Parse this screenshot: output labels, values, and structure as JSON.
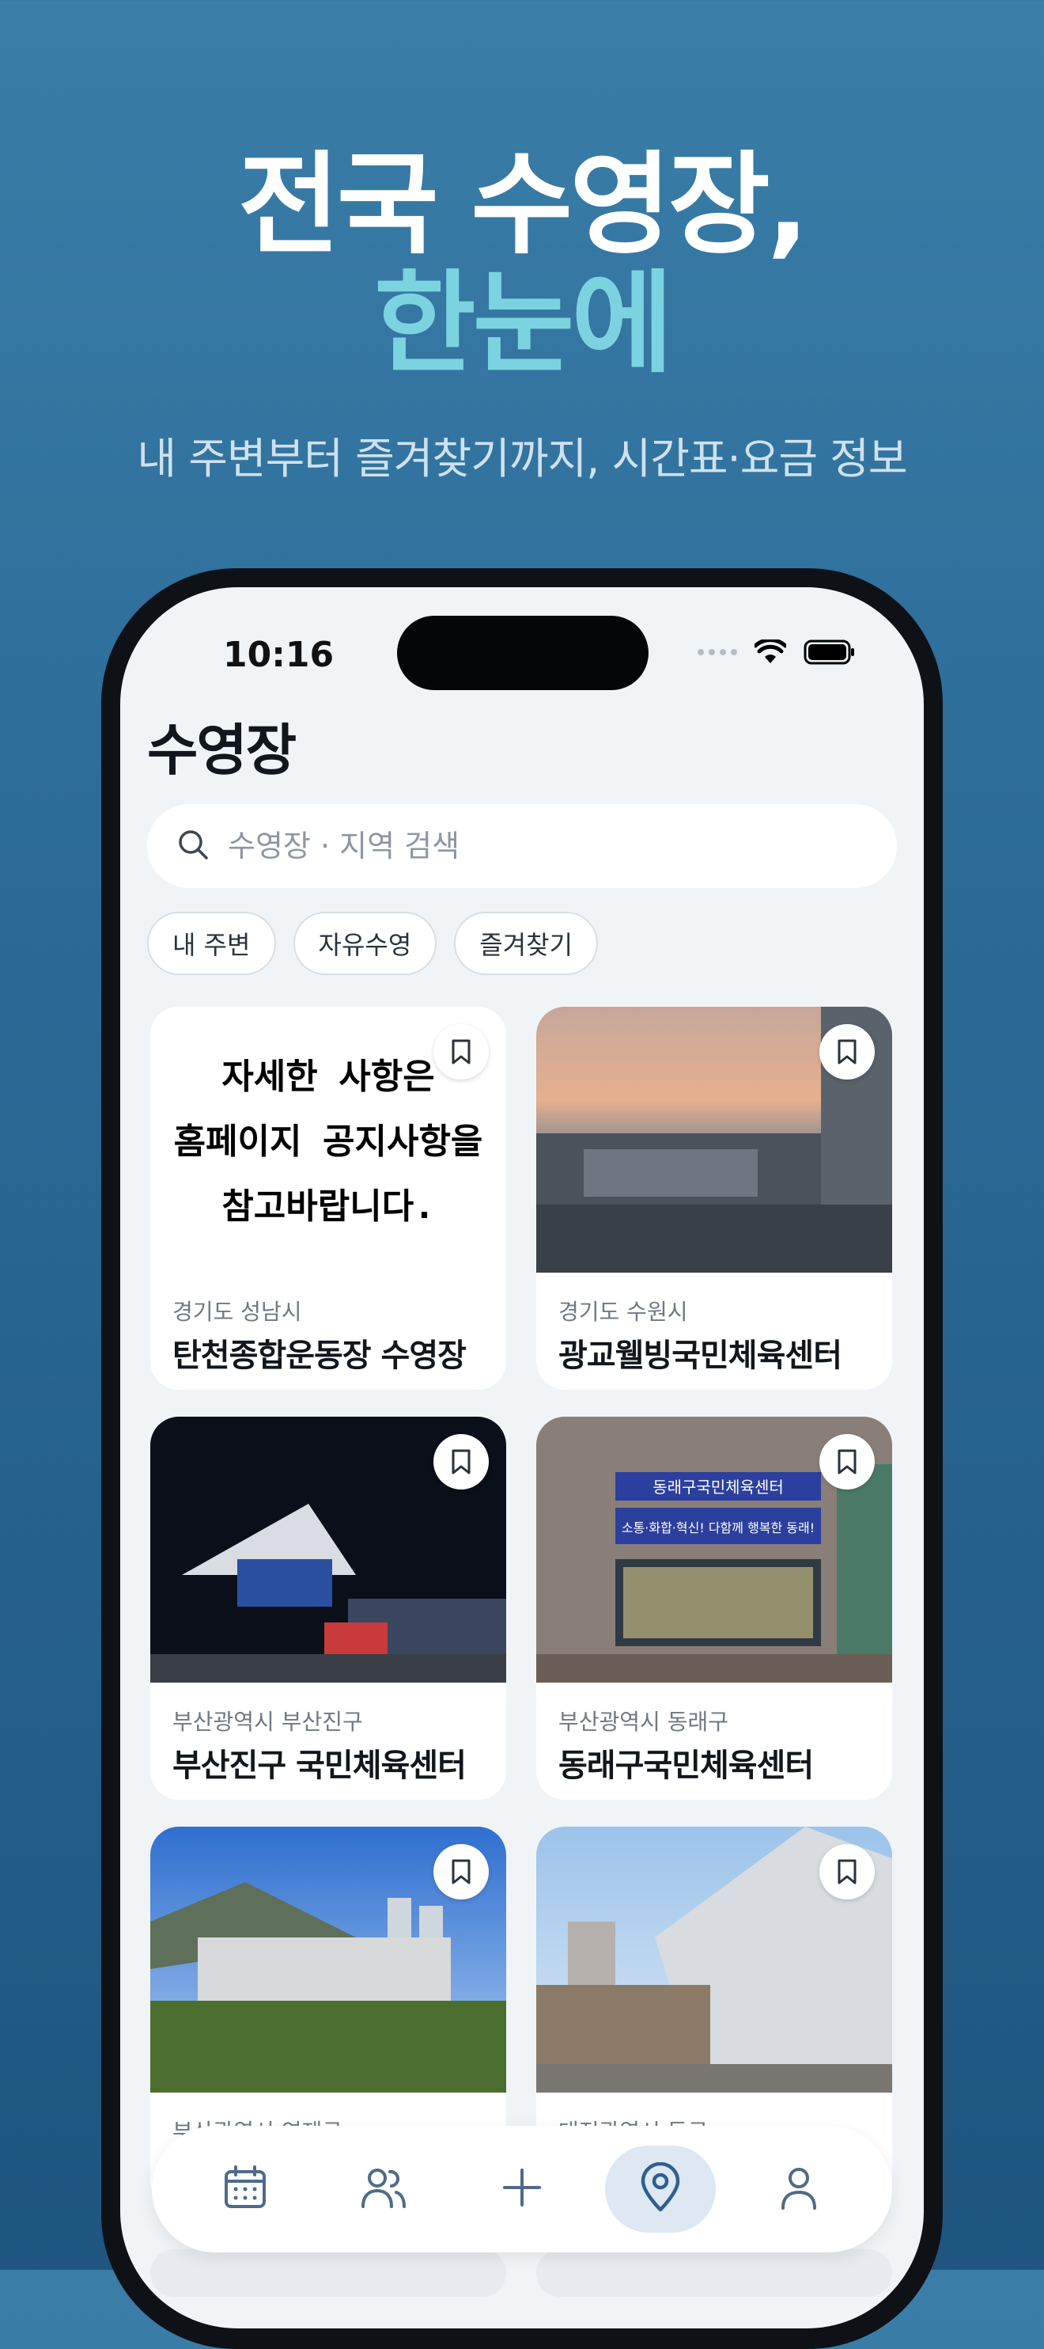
{
  "hero": {
    "line1": "전국 수영장,",
    "line2": "한눈에",
    "subtitle": "내 주변부터 즐겨찾기까지, 시간표·요금 정보"
  },
  "status_bar": {
    "time": "10:16"
  },
  "screen": {
    "title": "수영장",
    "search_placeholder": "수영장 · 지역 검색",
    "chips": [
      "내 주변",
      "자유수영",
      "즐겨찾기"
    ]
  },
  "cards": [
    {
      "region": "경기도 성남시",
      "name": "탄천종합운동장 수영장",
      "image_text": [
        "자세한 사항은",
        "홈페이지 공지사항을",
        "참고바랍니다."
      ]
    },
    {
      "region": "경기도 수원시",
      "name": "광교웰빙국민체육센터"
    },
    {
      "region": "부산광역시 부산진구",
      "name": "부산진구 국민체육센터"
    },
    {
      "region": "부산광역시 동래구",
      "name": "동래구국민체육센터",
      "image_text": [
        "동래구국민체육센터",
        "소통·화합·혁신! 다함께 행복한 동래!"
      ]
    },
    {
      "region": "부산광역시 연제구",
      "name": ""
    },
    {
      "region": "대전광역시 동구",
      "name": ""
    }
  ],
  "tabbar": {
    "items": [
      "calendar-icon",
      "people-icon",
      "plus-icon",
      "map-pin-icon",
      "person-icon"
    ],
    "active": "map-pin-icon"
  },
  "colors": {
    "accent": "#7cd3e0",
    "tab_icon": "#4f6b8a",
    "tab_active_bg": "#dde8f3",
    "background_top": "#3a7ea8",
    "background_bottom": "#1f557f"
  }
}
